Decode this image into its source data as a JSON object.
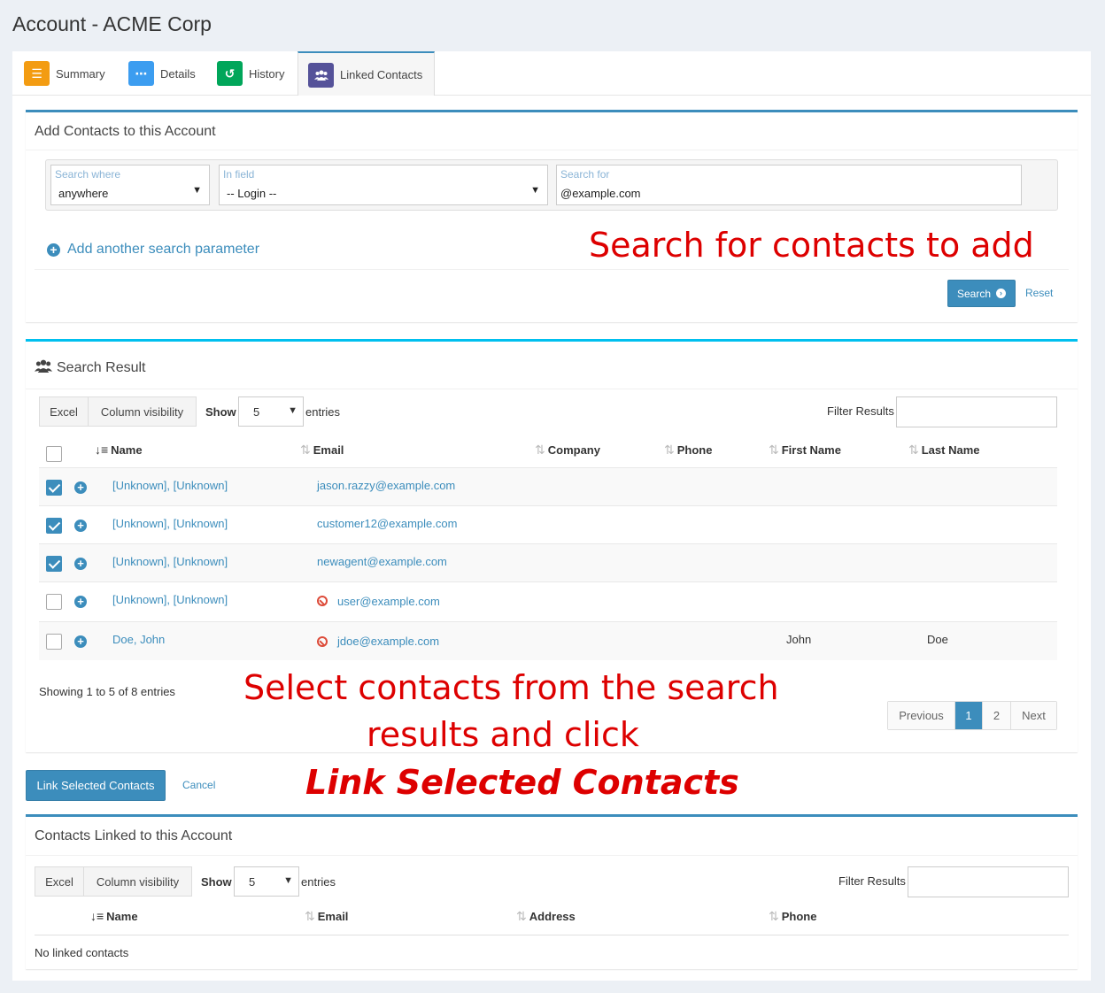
{
  "page_title": "Account - ACME Corp",
  "tabs": [
    {
      "label": "Summary",
      "icon": "list-icon",
      "color": "#f39c12"
    },
    {
      "label": "Details",
      "icon": "dots-icon",
      "color": "#3c9df0"
    },
    {
      "label": "History",
      "icon": "history-icon",
      "color": "#00a65a"
    },
    {
      "label": "Linked Contacts",
      "icon": "users-icon",
      "color": "#555299"
    }
  ],
  "add_box": {
    "title": "Add Contacts to this Account",
    "search_where_label": "Search where",
    "search_where_value": "anywhere",
    "in_field_label": "In field",
    "in_field_value": "-- Login --",
    "search_for_label": "Search for",
    "search_for_value": "@example.com",
    "add_param": "Add another search parameter",
    "search_btn": "Search",
    "reset": "Reset"
  },
  "annotations": {
    "search": "Search for contacts to add",
    "select_line1": "Select contacts from the search",
    "select_line2": "results and click",
    "link_selected": "Link Selected Contacts"
  },
  "results": {
    "title": "Search Result",
    "excel": "Excel",
    "colvis": "Column visibility",
    "show": "Show",
    "entries_value": "5",
    "entries": "entries",
    "filter": "Filter Results",
    "columns": [
      "Name",
      "Email",
      "Company",
      "Phone",
      "First Name",
      "Last Name"
    ],
    "rows": [
      {
        "checked": true,
        "name": "[Unknown], [Unknown]",
        "email": "jason.razzy@example.com",
        "blocked": false,
        "first": "",
        "last": ""
      },
      {
        "checked": true,
        "name": "[Unknown], [Unknown]",
        "email": "customer12@example.com",
        "blocked": false,
        "first": "",
        "last": ""
      },
      {
        "checked": true,
        "name": "[Unknown], [Unknown]",
        "email": "newagent@example.com",
        "blocked": false,
        "first": "",
        "last": ""
      },
      {
        "checked": false,
        "name": "[Unknown], [Unknown]",
        "email": "user@example.com",
        "blocked": true,
        "first": "",
        "last": ""
      },
      {
        "checked": false,
        "name": "Doe, John",
        "email": "jdoe@example.com",
        "blocked": true,
        "first": "John",
        "last": "Doe"
      }
    ],
    "info": "Showing 1 to 5 of 8 entries",
    "pager": {
      "prev": "Previous",
      "p1": "1",
      "p2": "2",
      "next": "Next"
    }
  },
  "actions": {
    "link": "Link Selected Contacts",
    "cancel": "Cancel"
  },
  "linked": {
    "title": "Contacts Linked to this Account",
    "excel": "Excel",
    "colvis": "Column visibility",
    "show": "Show",
    "entries_value": "5",
    "entries": "entries",
    "filter": "Filter Results",
    "columns": [
      "Name",
      "Email",
      "Address",
      "Phone"
    ],
    "empty": "No linked contacts"
  }
}
